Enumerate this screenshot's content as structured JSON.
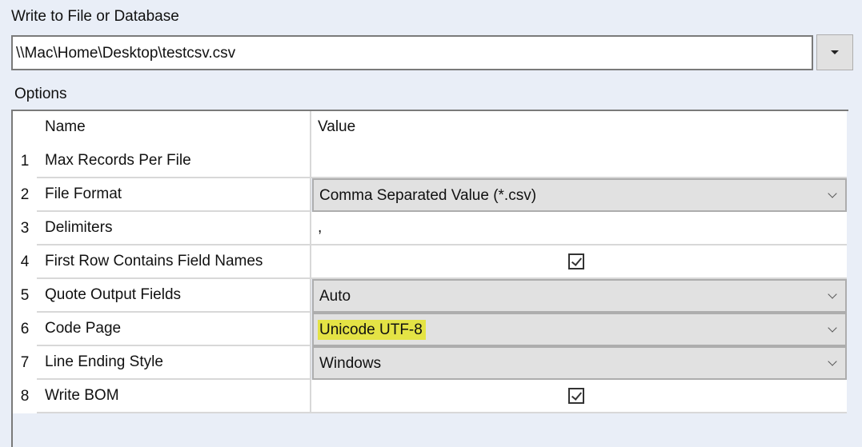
{
  "title": "Write to File or Database",
  "path": "\\\\Mac\\Home\\Desktop\\testcsv.csv",
  "options_label": "Options",
  "columns": {
    "name": "Name",
    "value": "Value"
  },
  "rows": [
    {
      "num": "1",
      "name": "Max Records Per File",
      "value": ""
    },
    {
      "num": "2",
      "name": "File Format",
      "value": "Comma Separated Value (*.csv)"
    },
    {
      "num": "3",
      "name": "Delimiters",
      "value": ","
    },
    {
      "num": "4",
      "name": "First Row Contains Field Names",
      "checked": true
    },
    {
      "num": "5",
      "name": "Quote Output Fields",
      "value": "Auto"
    },
    {
      "num": "6",
      "name": "Code Page",
      "value": "Unicode UTF-8"
    },
    {
      "num": "7",
      "name": "Line Ending Style",
      "value": "Windows"
    },
    {
      "num": "8",
      "name": "Write BOM",
      "checked": true
    }
  ],
  "highlight_color": "#e4e345"
}
